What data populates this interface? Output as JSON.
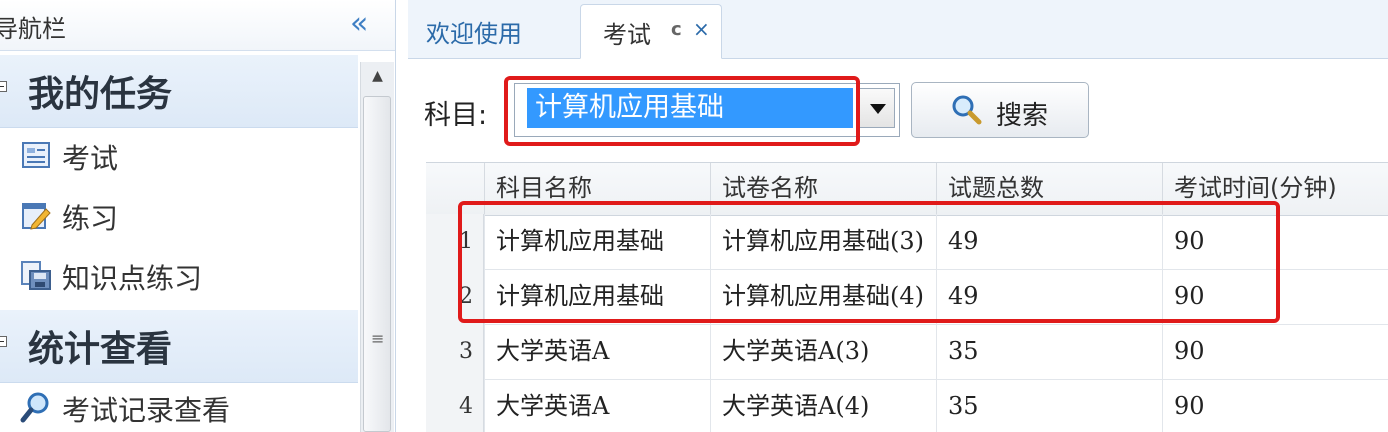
{
  "nav": {
    "title": "导航栏",
    "collapse_glyph": "«",
    "groups": [
      {
        "label": "我的任务",
        "items": [
          {
            "label": "考试",
            "icon": "exam-sheet-icon"
          },
          {
            "label": "练习",
            "icon": "practice-pencil-icon"
          },
          {
            "label": "知识点练习",
            "icon": "knowledge-disk-icon"
          }
        ]
      },
      {
        "label": "统计查看",
        "items": [
          {
            "label": "考试记录查看",
            "icon": "magnifier-icon"
          }
        ]
      }
    ],
    "scrollbar": {
      "up_glyph": "▲",
      "grip_glyph": "≡"
    }
  },
  "tabs": [
    {
      "label": "欢迎使用",
      "active": false
    },
    {
      "label": "考试",
      "active": true,
      "refresh_glyph": "c",
      "close_glyph": "×"
    }
  ],
  "filter": {
    "label": "科目:",
    "selected": "计算机应用基础",
    "search_button": "搜索"
  },
  "table": {
    "columns": [
      "科目名称",
      "试卷名称",
      "试题总数",
      "考试时间(分钟)"
    ],
    "rows": [
      {
        "num": "1",
        "subject": "计算机应用基础",
        "paper": "计算机应用基础(3)",
        "count": "49",
        "time": "90"
      },
      {
        "num": "2",
        "subject": "计算机应用基础",
        "paper": "计算机应用基础(4)",
        "count": "49",
        "time": "90"
      },
      {
        "num": "3",
        "subject": "大学英语A",
        "paper": "大学英语A(3)",
        "count": "35",
        "time": "90"
      },
      {
        "num": "4",
        "subject": "大学英语A",
        "paper": "大学英语A(4)",
        "count": "35",
        "time": "90"
      }
    ]
  },
  "colors": {
    "accent": "#2b6aa9",
    "selection": "#3399ff",
    "highlight_box": "#e01a1a"
  }
}
